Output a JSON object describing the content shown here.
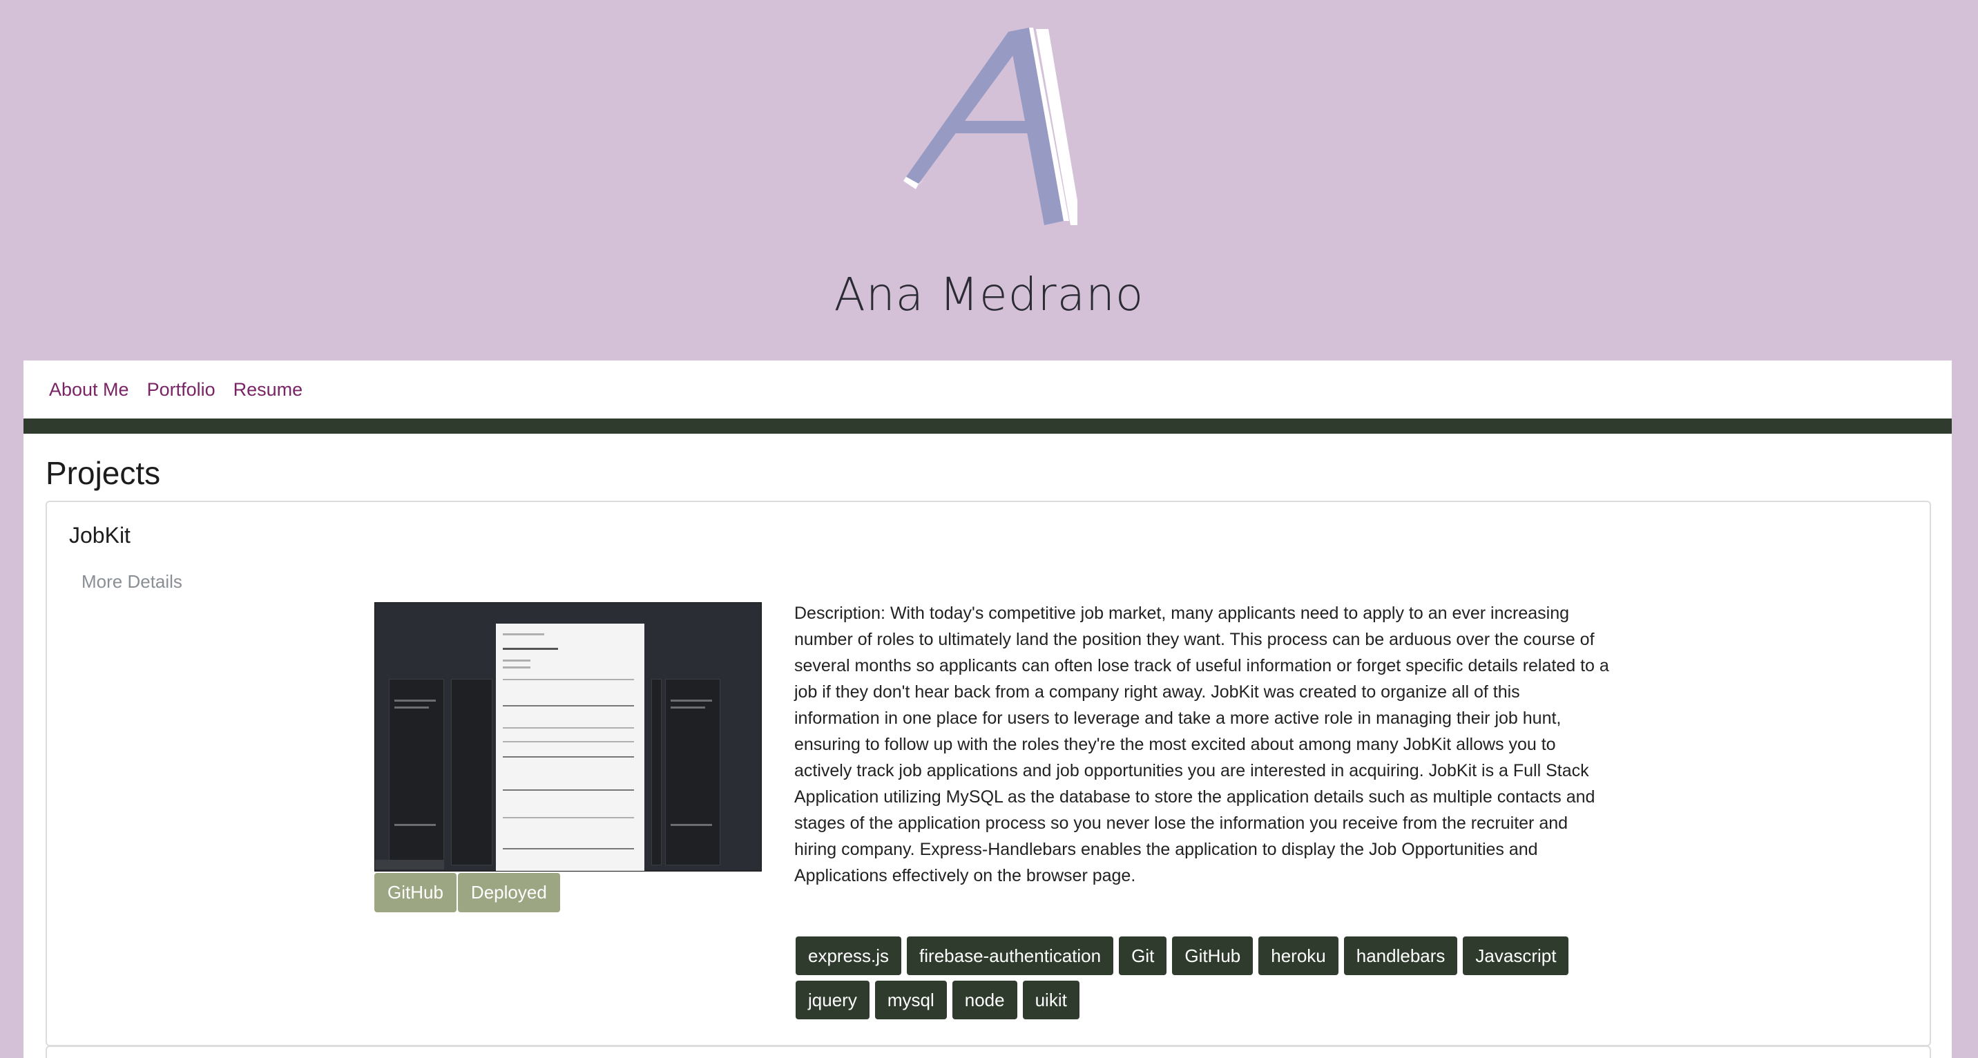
{
  "header": {
    "logo_icon": "stylized-letter-a-logo",
    "logo_colors": {
      "main": "#979bc4",
      "highlight": "#ffffff"
    },
    "name": "Ana Medrano"
  },
  "nav": {
    "items": [
      {
        "label": "About Me"
      },
      {
        "label": "Portfolio"
      },
      {
        "label": "Resume"
      }
    ]
  },
  "colors": {
    "background": "#d4c1d8",
    "accent_dark": "#2f3c2d",
    "nav_link": "#7a2466",
    "olive_button": "#9ca683"
  },
  "main": {
    "section_title": "Projects",
    "project": {
      "title": "JobKit",
      "more_details_label": "More Details",
      "screenshot_icon": "project-screenshot-image",
      "buttons": {
        "github": "GitHub",
        "deployed": "Deployed"
      },
      "description": "Description: With today's competitive job market, many applicants need to apply to an ever increasing number of roles to ultimately land the position they want. This process can be arduous over the course of several months so applicants can often lose track of useful information or forget specific details related to a job if they don't hear back from a company right away. JobKit was created to organize all of this information in one place for users to leverage and take a more active role in managing their job hunt, ensuring to follow up with the roles they're the most excited about among many JobKit allows you to actively track job applications and job opportunities you are interested in acquiring. JobKit is a Full Stack Application utilizing MySQL as the database to store the application details such as multiple contacts and stages of the application process so you never lose the information you receive from the recruiter and hiring company. Express-Handlebars enables the application to display the Job Opportunities and Applications effectively on the browser page.",
      "tags": [
        "express.js",
        "firebase-authentication",
        "Git",
        "GitHub",
        "heroku",
        "handlebars",
        "Javascript",
        "jquery",
        "mysql",
        "node",
        "uikit"
      ]
    }
  }
}
